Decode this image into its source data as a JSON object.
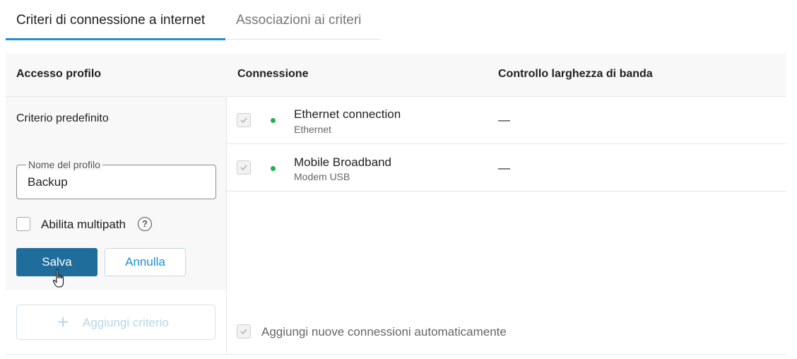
{
  "tabs": [
    {
      "label": "Criteri di connessione a internet",
      "active": true
    },
    {
      "label": "Associazioni ai criteri",
      "active": false
    }
  ],
  "table": {
    "headers": {
      "profile": "Accesso profilo",
      "connection": "Connessione",
      "bandwidth": "Controllo larghezza di banda"
    },
    "default_criterion": "Criterio predefinito",
    "connections": [
      {
        "name": "Ethernet connection",
        "type": "Ethernet",
        "bandwidth": "—",
        "checked": true,
        "status": "online"
      },
      {
        "name": "Mobile Broadband",
        "type": "Modem USB",
        "bandwidth": "—",
        "checked": true,
        "status": "online"
      }
    ],
    "auto_add_label": "Aggiungi nuove connessioni automaticamente"
  },
  "form": {
    "profile_name_label": "Nome del profilo",
    "profile_name_value": "Backup",
    "multipath_label": "Abilita multipath",
    "help_icon_glyph": "?",
    "save_label": "Salva",
    "cancel_label": "Annulla",
    "add_criterion_label": "Aggiungi criterio"
  },
  "colors": {
    "accent": "#1c8fd6",
    "save_button": "#1f6d9a",
    "status_online": "#1db34f"
  }
}
